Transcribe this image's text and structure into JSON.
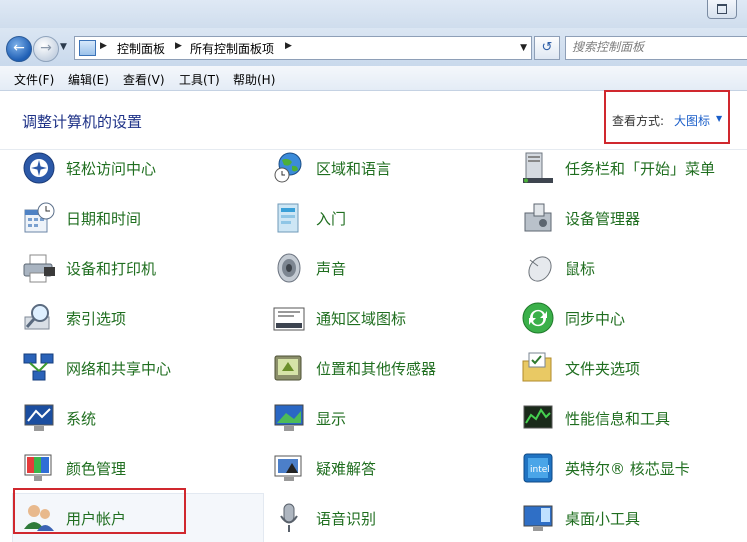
{
  "address": {
    "crumbs": [
      "控制面板",
      "所有控制面板项"
    ],
    "search_placeholder": "搜索控制面板"
  },
  "menu": [
    "文件(F)",
    "编辑(E)",
    "查看(V)",
    "工具(T)",
    "帮助(H)"
  ],
  "header": {
    "title": "调整计算机的设置",
    "view_label": "查看方式:",
    "view_value": "大图标"
  },
  "items": [
    {
      "label": "轻松访问中心",
      "icon": "ease-of-access-icon"
    },
    {
      "label": "区域和语言",
      "icon": "globe-clock-icon"
    },
    {
      "label": "任务栏和「开始」菜单",
      "icon": "taskbar-icon"
    },
    {
      "label": "日期和时间",
      "icon": "calendar-clock-icon"
    },
    {
      "label": "入门",
      "icon": "getting-started-icon"
    },
    {
      "label": "设备管理器",
      "icon": "device-manager-icon"
    },
    {
      "label": "设备和打印机",
      "icon": "printer-icon"
    },
    {
      "label": "声音",
      "icon": "speaker-icon"
    },
    {
      "label": "鼠标",
      "icon": "mouse-icon"
    },
    {
      "label": "索引选项",
      "icon": "magnifier-icon"
    },
    {
      "label": "通知区域图标",
      "icon": "notification-area-icon"
    },
    {
      "label": "同步中心",
      "icon": "sync-icon"
    },
    {
      "label": "网络和共享中心",
      "icon": "network-icon"
    },
    {
      "label": "位置和其他传感器",
      "icon": "location-sensor-icon"
    },
    {
      "label": "文件夹选项",
      "icon": "folder-options-icon"
    },
    {
      "label": "系统",
      "icon": "system-icon"
    },
    {
      "label": "显示",
      "icon": "display-icon"
    },
    {
      "label": "性能信息和工具",
      "icon": "performance-icon"
    },
    {
      "label": "颜色管理",
      "icon": "color-management-icon"
    },
    {
      "label": "疑难解答",
      "icon": "troubleshooting-icon"
    },
    {
      "label": "英特尔® 核芯显卡",
      "icon": "intel-graphics-icon"
    },
    {
      "label": "用户帐户",
      "icon": "user-accounts-icon"
    },
    {
      "label": "语音识别",
      "icon": "microphone-icon"
    },
    {
      "label": "桌面小工具",
      "icon": "desktop-gadgets-icon"
    }
  ],
  "colors": {
    "link_green": "#1f6e1f",
    "title_blue": "#1e3287",
    "highlight_red": "#d0282e"
  }
}
